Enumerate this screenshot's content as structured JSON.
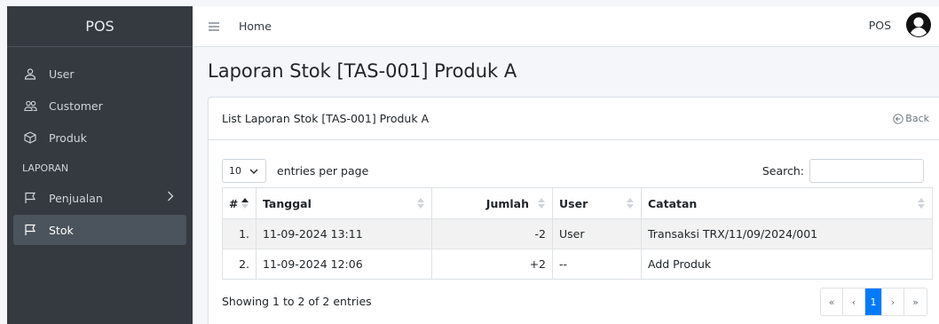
{
  "sidebar": {
    "brand": "POS",
    "items": [
      {
        "label": "User",
        "icon": "user-icon"
      },
      {
        "label": "Customer",
        "icon": "users-icon"
      },
      {
        "label": "Produk",
        "icon": "box-icon"
      }
    ],
    "section_header": "LAPORAN",
    "report_items": [
      {
        "label": "Penjualan",
        "icon": "flag-icon",
        "has_children": true
      },
      {
        "label": "Stok",
        "icon": "flag-icon",
        "active": true
      }
    ]
  },
  "topbar": {
    "home": "Home",
    "app_label": "POS"
  },
  "page": {
    "title": "Laporan Stok [TAS-001] Produk A"
  },
  "card": {
    "title": "List Laporan Stok [TAS-001] Produk A",
    "back": "Back"
  },
  "table_controls": {
    "length_value": "10",
    "length_label": "entries per page",
    "search_label": "Search:",
    "search_value": ""
  },
  "table": {
    "columns": [
      "#",
      "Tanggal",
      "Jumlah",
      "User",
      "Catatan"
    ],
    "rows": [
      {
        "no": "1.",
        "tanggal": "11-09-2024 13:11",
        "jumlah": "-2",
        "user": "User",
        "catatan": "Transaksi TRX/11/09/2024/001"
      },
      {
        "no": "2.",
        "tanggal": "11-09-2024 12:06",
        "jumlah": "+2",
        "user": "--",
        "catatan": "Add Produk"
      }
    ]
  },
  "footer": {
    "info": "Showing 1 to 2 of 2 entries",
    "pagination": {
      "first": "«",
      "prev": "‹",
      "current": "1",
      "next": "›",
      "last": "»"
    }
  },
  "colors": {
    "sidebar_bg": "#343a40",
    "active_item_bg": "#4b545c",
    "primary": "#007bff",
    "striped_row": "#f2f2f2"
  }
}
